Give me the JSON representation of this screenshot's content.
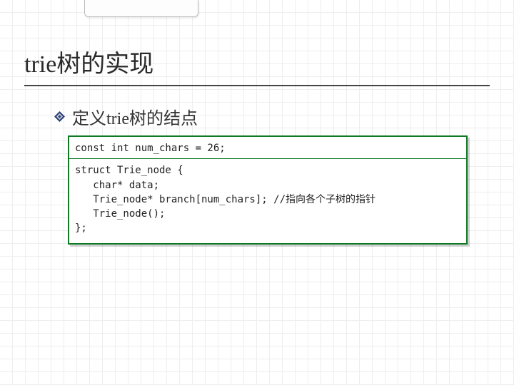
{
  "title": "trie树的实现",
  "bullet": {
    "text": "定义trie树的结点"
  },
  "code": {
    "line1": "const int num_chars = 26;",
    "block2": "struct Trie_node {\n   char* data;\n   Trie_node* branch[num_chars]; //指向各个子树的指针\n   Trie_node();\n};"
  }
}
